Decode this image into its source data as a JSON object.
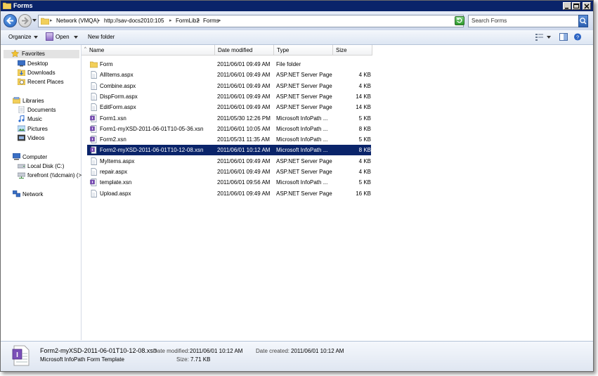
{
  "window": {
    "title": "Forms"
  },
  "address": {
    "crumbs": [
      "Network (VMQA)",
      "http://sav-docs2010:105",
      "FormLib2",
      "Forms"
    ]
  },
  "search": {
    "placeholder": "Search Forms"
  },
  "toolbar": {
    "organize": "Organize",
    "open": "Open",
    "new_folder": "New folder"
  },
  "sidebar": {
    "favorites": {
      "label": "Favorites",
      "items": [
        "Desktop",
        "Downloads",
        "Recent Places"
      ]
    },
    "libraries": {
      "label": "Libraries",
      "items": [
        "Documents",
        "Music",
        "Pictures",
        "Videos"
      ]
    },
    "computer": {
      "label": "Computer",
      "items": [
        "Local Disk (C:)",
        "forefront (\\\\dcmain) (>"
      ]
    },
    "network": {
      "label": "Network"
    }
  },
  "columns": {
    "name": "Name",
    "date": "Date modified",
    "type": "Type",
    "size": "Size"
  },
  "files": [
    {
      "name": "Form",
      "date": "2011/06/01 09:49 AM",
      "type": "File folder",
      "size": "",
      "kind": "folder"
    },
    {
      "name": "AllItems.aspx",
      "date": "2011/06/01 09:49 AM",
      "type": "ASP.NET Server Page",
      "size": "4 KB",
      "kind": "aspx"
    },
    {
      "name": "Combine.aspx",
      "date": "2011/06/01 09:49 AM",
      "type": "ASP.NET Server Page",
      "size": "4 KB",
      "kind": "aspx"
    },
    {
      "name": "DispForm.aspx",
      "date": "2011/06/01 09:49 AM",
      "type": "ASP.NET Server Page",
      "size": "14 KB",
      "kind": "aspx"
    },
    {
      "name": "EditForm.aspx",
      "date": "2011/06/01 09:49 AM",
      "type": "ASP.NET Server Page",
      "size": "14 KB",
      "kind": "aspx"
    },
    {
      "name": "Form1.xsn",
      "date": "2011/05/30 12:26 PM",
      "type": "Microsoft InfoPath ...",
      "size": "5 KB",
      "kind": "xsn"
    },
    {
      "name": "Form1-myXSD-2011-06-01T10-05-36.xsn",
      "date": "2011/06/01 10:05 AM",
      "type": "Microsoft InfoPath ...",
      "size": "8 KB",
      "kind": "xsn"
    },
    {
      "name": "Form2.xsn",
      "date": "2011/05/31 11:35 AM",
      "type": "Microsoft InfoPath ...",
      "size": "5 KB",
      "kind": "xsn"
    },
    {
      "name": "Form2-myXSD-2011-06-01T10-12-08.xsn",
      "date": "2011/06/01 10:12 AM",
      "type": "Microsoft InfoPath ...",
      "size": "8 KB",
      "kind": "xsn",
      "selected": true
    },
    {
      "name": "MyItems.aspx",
      "date": "2011/06/01 09:49 AM",
      "type": "ASP.NET Server Page",
      "size": "4 KB",
      "kind": "aspx"
    },
    {
      "name": "repair.aspx",
      "date": "2011/06/01 09:49 AM",
      "type": "ASP.NET Server Page",
      "size": "4 KB",
      "kind": "aspx"
    },
    {
      "name": "template.xsn",
      "date": "2011/06/01 09:56 AM",
      "type": "Microsoft InfoPath ...",
      "size": "5 KB",
      "kind": "xsn"
    },
    {
      "name": "Upload.aspx",
      "date": "2011/06/01 09:49 AM",
      "type": "ASP.NET Server Page",
      "size": "16 KB",
      "kind": "aspx"
    }
  ],
  "details": {
    "filename": "Form2-myXSD-2011-06-01T10-12-08.xsn",
    "modified_label": "Date modified:",
    "modified_value": "2011/06/01 10:12 AM",
    "created_label": "Date created:",
    "created_value": "2011/06/01 10:12 AM",
    "type": "Microsoft InfoPath Form Template",
    "size_label": "Size:",
    "size_value": "7.71 KB"
  },
  "colors": {
    "title_bar": "#0a246a",
    "selection": "#0a246a"
  }
}
